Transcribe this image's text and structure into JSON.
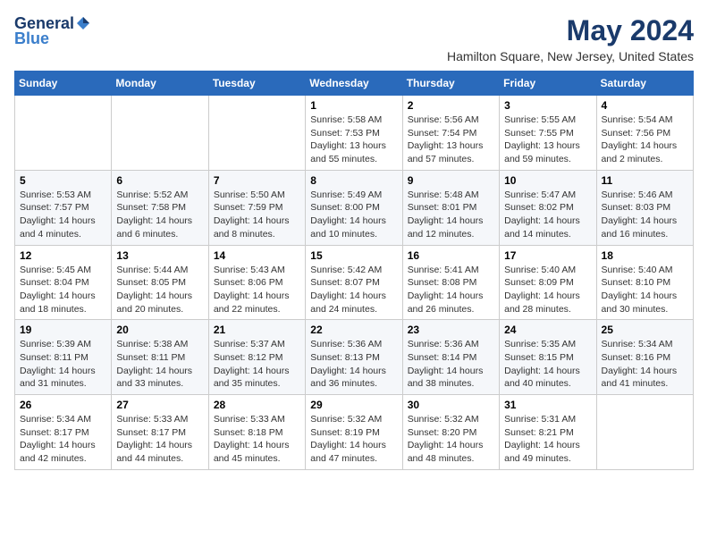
{
  "logo": {
    "general": "General",
    "blue": "Blue"
  },
  "title": "May 2024",
  "location": "Hamilton Square, New Jersey, United States",
  "days_of_week": [
    "Sunday",
    "Monday",
    "Tuesday",
    "Wednesday",
    "Thursday",
    "Friday",
    "Saturday"
  ],
  "weeks": [
    [
      {
        "day": "",
        "info": ""
      },
      {
        "day": "",
        "info": ""
      },
      {
        "day": "",
        "info": ""
      },
      {
        "day": "1",
        "info": "Sunrise: 5:58 AM\nSunset: 7:53 PM\nDaylight: 13 hours\nand 55 minutes."
      },
      {
        "day": "2",
        "info": "Sunrise: 5:56 AM\nSunset: 7:54 PM\nDaylight: 13 hours\nand 57 minutes."
      },
      {
        "day": "3",
        "info": "Sunrise: 5:55 AM\nSunset: 7:55 PM\nDaylight: 13 hours\nand 59 minutes."
      },
      {
        "day": "4",
        "info": "Sunrise: 5:54 AM\nSunset: 7:56 PM\nDaylight: 14 hours\nand 2 minutes."
      }
    ],
    [
      {
        "day": "5",
        "info": "Sunrise: 5:53 AM\nSunset: 7:57 PM\nDaylight: 14 hours\nand 4 minutes."
      },
      {
        "day": "6",
        "info": "Sunrise: 5:52 AM\nSunset: 7:58 PM\nDaylight: 14 hours\nand 6 minutes."
      },
      {
        "day": "7",
        "info": "Sunrise: 5:50 AM\nSunset: 7:59 PM\nDaylight: 14 hours\nand 8 minutes."
      },
      {
        "day": "8",
        "info": "Sunrise: 5:49 AM\nSunset: 8:00 PM\nDaylight: 14 hours\nand 10 minutes."
      },
      {
        "day": "9",
        "info": "Sunrise: 5:48 AM\nSunset: 8:01 PM\nDaylight: 14 hours\nand 12 minutes."
      },
      {
        "day": "10",
        "info": "Sunrise: 5:47 AM\nSunset: 8:02 PM\nDaylight: 14 hours\nand 14 minutes."
      },
      {
        "day": "11",
        "info": "Sunrise: 5:46 AM\nSunset: 8:03 PM\nDaylight: 14 hours\nand 16 minutes."
      }
    ],
    [
      {
        "day": "12",
        "info": "Sunrise: 5:45 AM\nSunset: 8:04 PM\nDaylight: 14 hours\nand 18 minutes."
      },
      {
        "day": "13",
        "info": "Sunrise: 5:44 AM\nSunset: 8:05 PM\nDaylight: 14 hours\nand 20 minutes."
      },
      {
        "day": "14",
        "info": "Sunrise: 5:43 AM\nSunset: 8:06 PM\nDaylight: 14 hours\nand 22 minutes."
      },
      {
        "day": "15",
        "info": "Sunrise: 5:42 AM\nSunset: 8:07 PM\nDaylight: 14 hours\nand 24 minutes."
      },
      {
        "day": "16",
        "info": "Sunrise: 5:41 AM\nSunset: 8:08 PM\nDaylight: 14 hours\nand 26 minutes."
      },
      {
        "day": "17",
        "info": "Sunrise: 5:40 AM\nSunset: 8:09 PM\nDaylight: 14 hours\nand 28 minutes."
      },
      {
        "day": "18",
        "info": "Sunrise: 5:40 AM\nSunset: 8:10 PM\nDaylight: 14 hours\nand 30 minutes."
      }
    ],
    [
      {
        "day": "19",
        "info": "Sunrise: 5:39 AM\nSunset: 8:11 PM\nDaylight: 14 hours\nand 31 minutes."
      },
      {
        "day": "20",
        "info": "Sunrise: 5:38 AM\nSunset: 8:11 PM\nDaylight: 14 hours\nand 33 minutes."
      },
      {
        "day": "21",
        "info": "Sunrise: 5:37 AM\nSunset: 8:12 PM\nDaylight: 14 hours\nand 35 minutes."
      },
      {
        "day": "22",
        "info": "Sunrise: 5:36 AM\nSunset: 8:13 PM\nDaylight: 14 hours\nand 36 minutes."
      },
      {
        "day": "23",
        "info": "Sunrise: 5:36 AM\nSunset: 8:14 PM\nDaylight: 14 hours\nand 38 minutes."
      },
      {
        "day": "24",
        "info": "Sunrise: 5:35 AM\nSunset: 8:15 PM\nDaylight: 14 hours\nand 40 minutes."
      },
      {
        "day": "25",
        "info": "Sunrise: 5:34 AM\nSunset: 8:16 PM\nDaylight: 14 hours\nand 41 minutes."
      }
    ],
    [
      {
        "day": "26",
        "info": "Sunrise: 5:34 AM\nSunset: 8:17 PM\nDaylight: 14 hours\nand 42 minutes."
      },
      {
        "day": "27",
        "info": "Sunrise: 5:33 AM\nSunset: 8:17 PM\nDaylight: 14 hours\nand 44 minutes."
      },
      {
        "day": "28",
        "info": "Sunrise: 5:33 AM\nSunset: 8:18 PM\nDaylight: 14 hours\nand 45 minutes."
      },
      {
        "day": "29",
        "info": "Sunrise: 5:32 AM\nSunset: 8:19 PM\nDaylight: 14 hours\nand 47 minutes."
      },
      {
        "day": "30",
        "info": "Sunrise: 5:32 AM\nSunset: 8:20 PM\nDaylight: 14 hours\nand 48 minutes."
      },
      {
        "day": "31",
        "info": "Sunrise: 5:31 AM\nSunset: 8:21 PM\nDaylight: 14 hours\nand 49 minutes."
      },
      {
        "day": "",
        "info": ""
      }
    ]
  ]
}
